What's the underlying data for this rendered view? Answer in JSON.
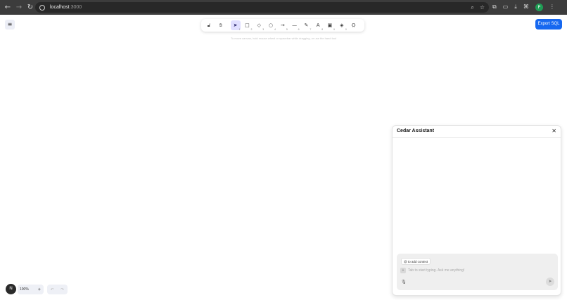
{
  "browser": {
    "host": "localhost",
    "port": ":3000",
    "back_glyph": "←",
    "forward_glyph": "→",
    "reload_glyph": "↻",
    "zoom_glyph": "⌕",
    "star_glyph": "☆",
    "extensions_glyph": "⧉",
    "cast_glyph": "▭",
    "download_glyph": "⤓",
    "profile_letter": "P",
    "menu_glyph": "⋮"
  },
  "app": {
    "menu_glyph": "≡",
    "hint": "To move canvas, hold mouse wheel or spacebar while dragging, or use the hand tool",
    "export_label": "Export SQL",
    "tools": [
      {
        "name": "lock-icon",
        "glyph": "🔓︎",
        "key": ""
      },
      {
        "name": "hand-icon",
        "glyph": "✋︎",
        "key": ""
      },
      {
        "name": "selection-icon",
        "glyph": "➤",
        "key": "1"
      },
      {
        "name": "rectangle-icon",
        "glyph": "□",
        "key": "2"
      },
      {
        "name": "diamond-icon",
        "glyph": "◇",
        "key": "3"
      },
      {
        "name": "ellipse-icon",
        "glyph": "○",
        "key": "4"
      },
      {
        "name": "arrow-icon",
        "glyph": "→",
        "key": "5"
      },
      {
        "name": "line-icon",
        "glyph": "—",
        "key": "6"
      },
      {
        "name": "pencil-icon",
        "glyph": "✎",
        "key": "7"
      },
      {
        "name": "text-icon",
        "glyph": "A",
        "key": "8"
      },
      {
        "name": "image-icon",
        "glyph": "▣",
        "key": "9"
      },
      {
        "name": "eraser-icon",
        "glyph": "◈",
        "key": "0"
      },
      {
        "name": "library-icon",
        "glyph": "⛭",
        "key": ""
      }
    ],
    "active_tool": "selection-icon",
    "avatar_letter": "N",
    "zoom_value": "100%",
    "zoom_plus": "+",
    "undo_glyph": "↶",
    "redo_glyph": "↷"
  },
  "assistant": {
    "title": "Cedar Assistant",
    "close_glyph": "✕",
    "context_chip": "@ to add context",
    "add_glyph": "+",
    "input_placeholder": "Tab to start typing. Ask me anything!",
    "input_value": "",
    "mic_glyph": "🎙︎",
    "send_glyph": "➤"
  },
  "colors": {
    "accent": "#1668f0",
    "active_tool_bg": "#e0dfff",
    "chrome_bg": "#3c3c3c"
  }
}
